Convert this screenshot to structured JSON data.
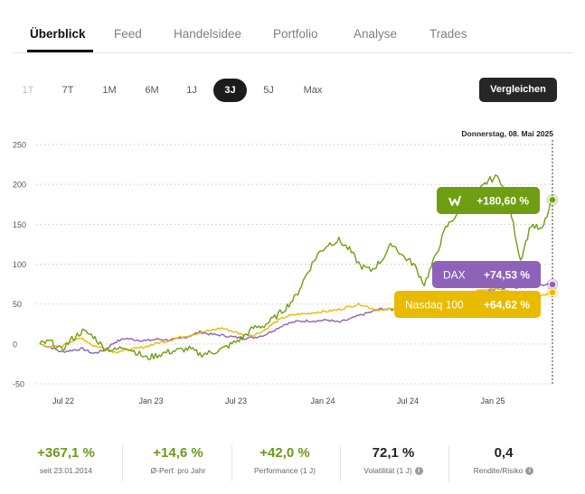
{
  "tabs": [
    {
      "label": "Überblick"
    },
    {
      "label": "Feed"
    },
    {
      "label": "Handelsidee"
    },
    {
      "label": "Portfolio"
    },
    {
      "label": "Analyse"
    },
    {
      "label": "Trades"
    }
  ],
  "ranges": [
    {
      "label": "1T",
      "state": "disabled"
    },
    {
      "label": "7T",
      "state": "normal"
    },
    {
      "label": "1M",
      "state": "normal"
    },
    {
      "label": "6M",
      "state": "normal"
    },
    {
      "label": "1J",
      "state": "normal"
    },
    {
      "label": "3J",
      "state": "active"
    },
    {
      "label": "5J",
      "state": "normal"
    },
    {
      "label": "Max",
      "state": "normal"
    }
  ],
  "compare_label": "Vergleichen",
  "colors": {
    "wikifolio": "#6f9e12",
    "dax": "#8d62b8",
    "nasdaq": "#e8bb00",
    "positive": "#6a9a1a"
  },
  "chart_data": {
    "type": "line",
    "date_label": "Donnerstag, 08. Mai 2025",
    "x_ticks": [
      "Jul 22",
      "Jan 23",
      "Jul 23",
      "Jan 24",
      "Jul 24",
      "Jan 25"
    ],
    "y_ticks": [
      "250",
      "200",
      "150",
      "100",
      "50",
      "0",
      "-50"
    ],
    "ylim": [
      -50,
      250
    ],
    "x_range": [
      "2022-05",
      "2025-05"
    ],
    "grid": true,
    "series": [
      {
        "name": "wikifolio",
        "label": "+180,60 %",
        "icon": "wikifolio-logo-icon",
        "color": "#6f9e12",
        "values": [
          0,
          3,
          -8,
          6,
          16,
          10,
          -5,
          -8,
          -3,
          -10,
          -18,
          -14,
          -10,
          -8,
          -6,
          -13,
          -11,
          -7,
          0,
          8,
          20,
          23,
          33,
          45,
          60,
          88,
          112,
          125,
          130,
          118,
          98,
          92,
          105,
          126,
          110,
          100,
          75,
          108,
          145,
          162,
          175,
          190,
          205,
          210,
          172,
          105,
          150,
          142,
          180.6
        ]
      },
      {
        "name": "DAX",
        "label": "+74,53 %",
        "color": "#8d62b8",
        "values": [
          0,
          -4,
          -10,
          -8,
          -6,
          -12,
          -8,
          2,
          7,
          5,
          4,
          6,
          5,
          6,
          10,
          15,
          12,
          11,
          9,
          7,
          8,
          11,
          18,
          25,
          28,
          29,
          29,
          30,
          27,
          31,
          36,
          40,
          44,
          43,
          45,
          46,
          48,
          52,
          50,
          57,
          60,
          64,
          66,
          69,
          72,
          70,
          72,
          74,
          74.53
        ]
      },
      {
        "name": "Nasdaq 100",
        "label": "+64,62 %",
        "color": "#e8bb00",
        "values": [
          0,
          -4,
          -3,
          4,
          7,
          -2,
          -5,
          -10,
          -8,
          -6,
          -3,
          1,
          4,
          8,
          11,
          14,
          17,
          20,
          16,
          12,
          11,
          17,
          27,
          34,
          37,
          38,
          40,
          41,
          43,
          47,
          50,
          45,
          42,
          44,
          48,
          51,
          56,
          60,
          58,
          60,
          62,
          68,
          69,
          70,
          66,
          55,
          54,
          60,
          64.62
        ]
      }
    ]
  },
  "stats": [
    {
      "value": "+367,1 %",
      "label": "seit 23.01.2014",
      "positive": true,
      "info": false
    },
    {
      "value": "+14,6 %",
      "label": "Ø-Perf. pro Jahr",
      "positive": true,
      "info": false
    },
    {
      "value": "+42,0 %",
      "label": "Performance (1 J)",
      "positive": true,
      "info": false
    },
    {
      "value": "72,1 %",
      "label": "Volatilität (1 J)",
      "positive": false,
      "info": true
    },
    {
      "value": "0,4",
      "label": "Rendite/Risiko",
      "positive": false,
      "info": true
    }
  ]
}
